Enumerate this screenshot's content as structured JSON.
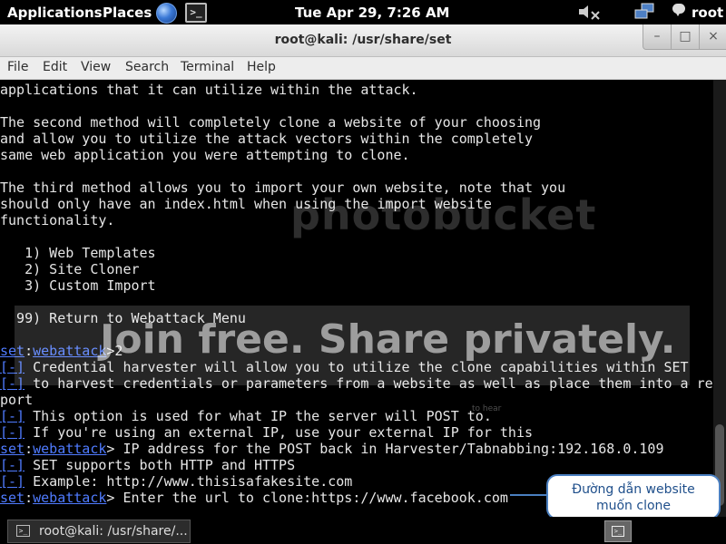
{
  "panel": {
    "applications": "Applications",
    "places": "Places",
    "terminal_glyph": ">_",
    "clock": "Tue Apr 29,  7:26 AM",
    "user": "root",
    "icons": [
      "globe-icon",
      "terminal-icon",
      "volume-muted-icon",
      "network-icon",
      "chat-icon"
    ]
  },
  "window": {
    "title": "root@kali: /usr/share/set",
    "min": "–",
    "max": "□",
    "close": "×",
    "menu": [
      "File",
      "Edit",
      "View",
      "Search",
      "Terminal",
      "Help"
    ]
  },
  "terminal": {
    "lines": [
      {
        "segs": [
          {
            "t": "applications that it can utilize within the attack."
          }
        ]
      },
      {
        "segs": [
          {
            "t": ""
          }
        ]
      },
      {
        "segs": [
          {
            "t": "The second method will completely clone a website of your choosing"
          }
        ]
      },
      {
        "segs": [
          {
            "t": "and allow you to utilize the attack vectors within the completely"
          }
        ]
      },
      {
        "segs": [
          {
            "t": "same web application you were attempting to clone."
          }
        ]
      },
      {
        "segs": [
          {
            "t": ""
          }
        ]
      },
      {
        "segs": [
          {
            "t": "The third method allows you to import your own website, note that you"
          }
        ]
      },
      {
        "segs": [
          {
            "t": "should only have an index.html when using the import website"
          }
        ]
      },
      {
        "segs": [
          {
            "t": "functionality."
          }
        ]
      },
      {
        "segs": [
          {
            "t": ""
          }
        ]
      },
      {
        "segs": [
          {
            "t": "   1) Web Templates"
          }
        ]
      },
      {
        "segs": [
          {
            "t": "   2) Site Cloner"
          }
        ]
      },
      {
        "segs": [
          {
            "t": "   3) Custom Import"
          }
        ]
      },
      {
        "segs": [
          {
            "t": ""
          }
        ]
      },
      {
        "segs": [
          {
            "t": "  99) Return to Webattack Menu"
          }
        ]
      },
      {
        "segs": [
          {
            "t": ""
          }
        ]
      },
      {
        "segs": [
          {
            "t": "set",
            "c": "blue"
          },
          {
            "t": ":"
          },
          {
            "t": "webattack",
            "c": "blue"
          },
          {
            "t": ">2"
          }
        ]
      },
      {
        "segs": [
          {
            "t": "[-]",
            "c": "blue"
          },
          {
            "t": " Credential harvester will allow you to utilize the clone capabilities within SET"
          }
        ]
      },
      {
        "segs": [
          {
            "t": "[-]",
            "c": "blue"
          },
          {
            "t": " to harvest credentials or parameters from a website as well as place them into a re"
          }
        ]
      },
      {
        "segs": [
          {
            "t": "port"
          }
        ]
      },
      {
        "segs": [
          {
            "t": "[-]",
            "c": "blue"
          },
          {
            "t": " This option is used for what IP the server will POST to."
          }
        ]
      },
      {
        "segs": [
          {
            "t": "[-]",
            "c": "blue"
          },
          {
            "t": " If you're using an external IP, use your external IP for this"
          }
        ]
      },
      {
        "segs": [
          {
            "t": "set",
            "c": "blue"
          },
          {
            "t": ":"
          },
          {
            "t": "webattack",
            "c": "blue"
          },
          {
            "t": "> IP address for the POST back in Harvester/Tabnabbing:192.168.0.109"
          }
        ]
      },
      {
        "segs": [
          {
            "t": "[-]",
            "c": "blue"
          },
          {
            "t": " SET supports both HTTP and HTTPS"
          }
        ]
      },
      {
        "segs": [
          {
            "t": "[-]",
            "c": "blue"
          },
          {
            "t": " Example: http://www.thisisafakesite.com"
          }
        ]
      },
      {
        "segs": [
          {
            "t": "set",
            "c": "blue"
          },
          {
            "t": ":"
          },
          {
            "t": "webattack",
            "c": "blue"
          },
          {
            "t": "> Enter the url to clone:https://www.facebook.com"
          }
        ]
      }
    ]
  },
  "watermark": {
    "brand": "photobucket",
    "tagline": "Join free. Share privately.",
    "hint": "to hear"
  },
  "callout": {
    "line1": "Đường dẫn website",
    "line2": "muốn clone",
    "color": "#4a7fc0"
  },
  "taskbar": {
    "window_label": "root@kali: /usr/share/...",
    "icon_glyph": ">_"
  }
}
